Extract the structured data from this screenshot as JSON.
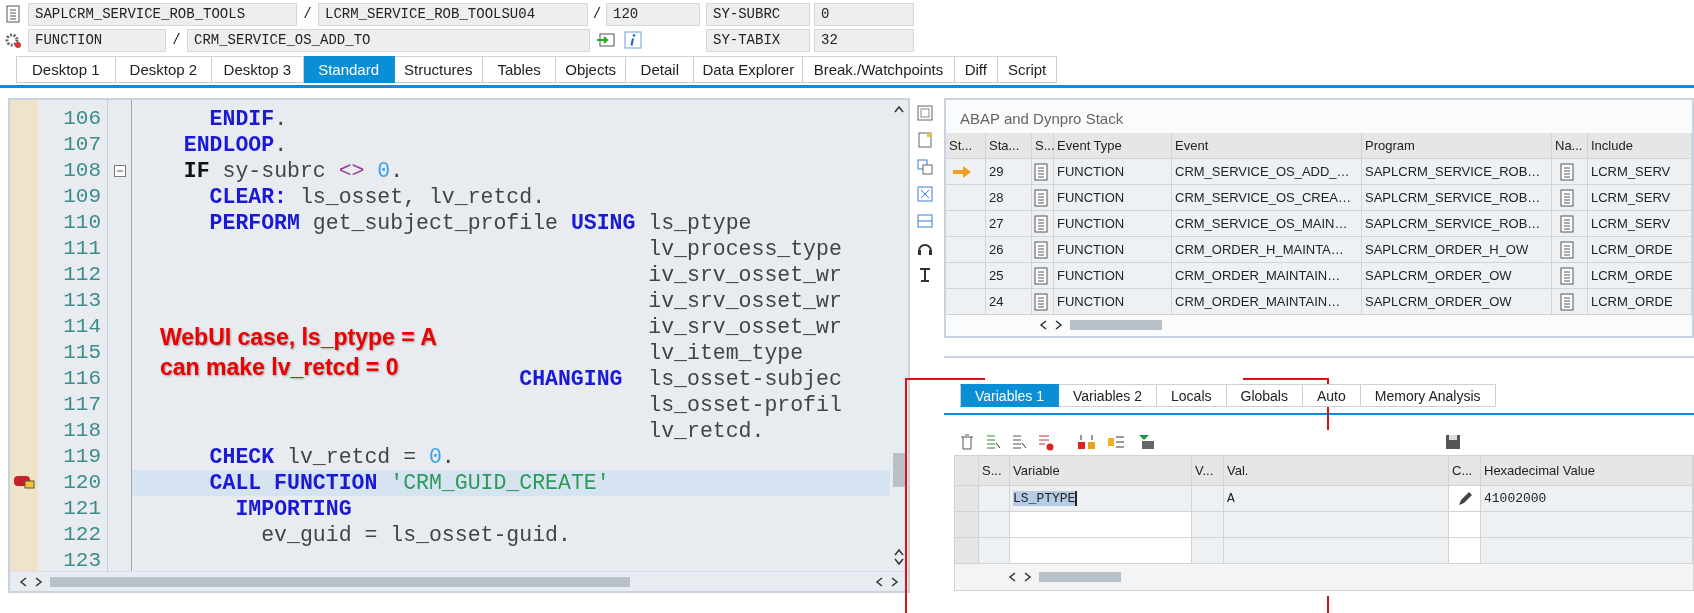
{
  "header": {
    "rows": [
      {
        "kind": "program",
        "fields": [
          {
            "kind": "field",
            "text": "SAPLCRM_SERVICE_ROB_TOOLS"
          },
          {
            "kind": "sep",
            "text": "/"
          },
          {
            "kind": "field",
            "text": "LCRM_SERVICE_ROB_TOOLSU04"
          },
          {
            "kind": "sep",
            "text": "/"
          },
          {
            "kind": "field",
            "text": "120"
          }
        ],
        "sys_name": "SY-SUBRC",
        "sys_value": "0"
      },
      {
        "kind": "event",
        "fields": [
          {
            "kind": "field",
            "text": "FUNCTION"
          },
          {
            "kind": "sep",
            "text": "/"
          },
          {
            "kind": "field",
            "text": "CRM_SERVICE_OS_ADD_TO"
          }
        ],
        "sys_name": "SY-TABIX",
        "sys_value": "32"
      }
    ]
  },
  "tabs": [
    {
      "label": "Desktop 1",
      "selected": false
    },
    {
      "label": "Desktop 2",
      "selected": false
    },
    {
      "label": "Desktop 3",
      "selected": false
    },
    {
      "label": "Standard",
      "selected": true
    },
    {
      "label": "Structures",
      "selected": false
    },
    {
      "label": "Tables",
      "selected": false
    },
    {
      "label": "Objects",
      "selected": false
    },
    {
      "label": "Detail",
      "selected": false
    },
    {
      "label": "Data Explorer",
      "selected": false
    },
    {
      "label": "Break./Watchpoints",
      "selected": false
    },
    {
      "label": "Diff",
      "selected": false
    },
    {
      "label": "Script",
      "selected": false
    }
  ],
  "editor": {
    "lines": [
      {
        "number": "106",
        "breakpoint": false,
        "current": false,
        "foldable": false,
        "tokens": [
          {
            "kind": "kw",
            "text": "    ENDIF"
          },
          {
            "kind": "id",
            "text": "."
          }
        ]
      },
      {
        "number": "107",
        "breakpoint": false,
        "current": false,
        "foldable": false,
        "tokens": [
          {
            "kind": "kw",
            "text": "  ENDLOOP"
          },
          {
            "kind": "id",
            "text": "."
          }
        ]
      },
      {
        "number": "108",
        "breakpoint": false,
        "current": false,
        "foldable": true,
        "tokens": [
          {
            "kind": "kwb",
            "text": "  IF"
          },
          {
            "kind": "id",
            "text": " sy-subrc "
          },
          {
            "kind": "op",
            "text": "<>"
          },
          {
            "kind": "num",
            "text": " 0"
          },
          {
            "kind": "id",
            "text": "."
          }
        ]
      },
      {
        "number": "109",
        "breakpoint": false,
        "current": false,
        "foldable": false,
        "tokens": [
          {
            "kind": "kw",
            "text": "    CLEAR:"
          },
          {
            "kind": "id",
            "text": " ls_osset, lv_retcd."
          }
        ]
      },
      {
        "number": "110",
        "breakpoint": false,
        "current": false,
        "foldable": false,
        "tokens": [
          {
            "kind": "kw",
            "text": "    PERFORM"
          },
          {
            "kind": "id",
            "text": " get_subject_profile "
          },
          {
            "kind": "kw",
            "text": "USING"
          },
          {
            "kind": "id",
            "text": " ls_ptype"
          }
        ]
      },
      {
        "number": "111",
        "breakpoint": false,
        "current": false,
        "foldable": false,
        "tokens": [
          {
            "kind": "id",
            "text": "                                      lv_process_type"
          }
        ]
      },
      {
        "number": "112",
        "breakpoint": false,
        "current": false,
        "foldable": false,
        "tokens": [
          {
            "kind": "id",
            "text": "                                      iv_srv_osset_wr"
          }
        ]
      },
      {
        "number": "113",
        "breakpoint": false,
        "current": false,
        "foldable": false,
        "tokens": [
          {
            "kind": "id",
            "text": "                                      iv_srv_osset_wr"
          }
        ]
      },
      {
        "number": "114",
        "breakpoint": false,
        "current": false,
        "foldable": false,
        "tokens": [
          {
            "kind": "id",
            "text": "                                      iv_srv_osset_wr"
          }
        ]
      },
      {
        "number": "115",
        "breakpoint": false,
        "current": false,
        "foldable": false,
        "tokens": [
          {
            "kind": "id",
            "text": "                                      lv_item_type"
          }
        ]
      },
      {
        "number": "116",
        "breakpoint": false,
        "current": false,
        "foldable": false,
        "tokens": [
          {
            "kind": "kw",
            "text": "                            CHANGING"
          },
          {
            "kind": "id",
            "text": "  ls_osset-subjec"
          }
        ]
      },
      {
        "number": "117",
        "breakpoint": false,
        "current": false,
        "foldable": false,
        "tokens": [
          {
            "kind": "id",
            "text": "                                      ls_osset-profil"
          }
        ]
      },
      {
        "number": "118",
        "breakpoint": false,
        "current": false,
        "foldable": false,
        "tokens": [
          {
            "kind": "id",
            "text": "                                      lv_retcd."
          }
        ]
      },
      {
        "number": "119",
        "breakpoint": false,
        "current": false,
        "foldable": false,
        "tokens": [
          {
            "kind": "kw",
            "text": "    CHECK"
          },
          {
            "kind": "id",
            "text": " lv_retcd = "
          },
          {
            "kind": "num",
            "text": "0"
          },
          {
            "kind": "id",
            "text": "."
          }
        ]
      },
      {
        "number": "120",
        "breakpoint": true,
        "current": true,
        "foldable": false,
        "tokens": [
          {
            "kind": "kw",
            "text": "    CALL FUNCTION"
          },
          {
            "kind": "str",
            "text": " 'CRM_GUID_CREATE'"
          }
        ]
      },
      {
        "number": "121",
        "breakpoint": false,
        "current": false,
        "foldable": false,
        "tokens": [
          {
            "kind": "kw",
            "text": "      IMPORTING"
          }
        ]
      },
      {
        "number": "122",
        "breakpoint": false,
        "current": false,
        "foldable": false,
        "tokens": [
          {
            "kind": "id",
            "text": "        ev_guid = ls_osset-guid."
          }
        ]
      },
      {
        "number": "123",
        "breakpoint": false,
        "current": false,
        "foldable": false
      }
    ],
    "annotation": [
      "WebUI case, ls_ptype = A",
      "can make lv_retcd = 0"
    ]
  },
  "stack": {
    "title": "ABAP and Dynpro Stack",
    "columns": [
      "St...",
      "Sta...",
      "S...",
      "Event Type",
      "Event",
      "Program",
      "Na...",
      "Include"
    ],
    "rows": [
      {
        "current": true,
        "number": "29",
        "event_type": "FUNCTION",
        "event": "CRM_SERVICE_OS_ADD_…",
        "program": "SAPLCRM_SERVICE_ROB…",
        "include": "LCRM_SERV"
      },
      {
        "current": false,
        "number": "28",
        "event_type": "FUNCTION",
        "event": "CRM_SERVICE_OS_CREA…",
        "program": "SAPLCRM_SERVICE_ROB…",
        "include": "LCRM_SERV"
      },
      {
        "current": false,
        "number": "27",
        "event_type": "FUNCTION",
        "event": "CRM_SERVICE_OS_MAIN…",
        "program": "SAPLCRM_SERVICE_ROB…",
        "include": "LCRM_SERV"
      },
      {
        "current": false,
        "number": "26",
        "event_type": "FUNCTION",
        "event": "CRM_ORDER_H_MAINTA…",
        "program": "SAPLCRM_ORDER_H_OW",
        "include": "LCRM_ORDE"
      },
      {
        "current": false,
        "number": "25",
        "event_type": "FUNCTION",
        "event": "CRM_ORDER_MAINTAIN…",
        "program": "SAPLCRM_ORDER_OW",
        "include": "LCRM_ORDE"
      },
      {
        "current": false,
        "number": "24",
        "event_type": "FUNCTION",
        "event": "CRM_ORDER_MAINTAIN…",
        "program": "SAPLCRM_ORDER_OW",
        "include": "LCRM_ORDE"
      }
    ]
  },
  "variables": {
    "tabs": [
      {
        "label": "Variables 1",
        "selected": true
      },
      {
        "label": "Variables 2",
        "selected": false
      },
      {
        "label": "Locals",
        "selected": false
      },
      {
        "label": "Globals",
        "selected": false
      },
      {
        "label": "Auto",
        "selected": false
      },
      {
        "label": "Memory Analysis",
        "selected": false
      }
    ],
    "columns": [
      "S...",
      "Variable",
      "V...",
      "Val.",
      "C...",
      "Hexadecimal Value"
    ],
    "rows": [
      {
        "variable": "LS_PTYPE",
        "selected": true,
        "value": "A",
        "hex": "41002000"
      }
    ]
  }
}
